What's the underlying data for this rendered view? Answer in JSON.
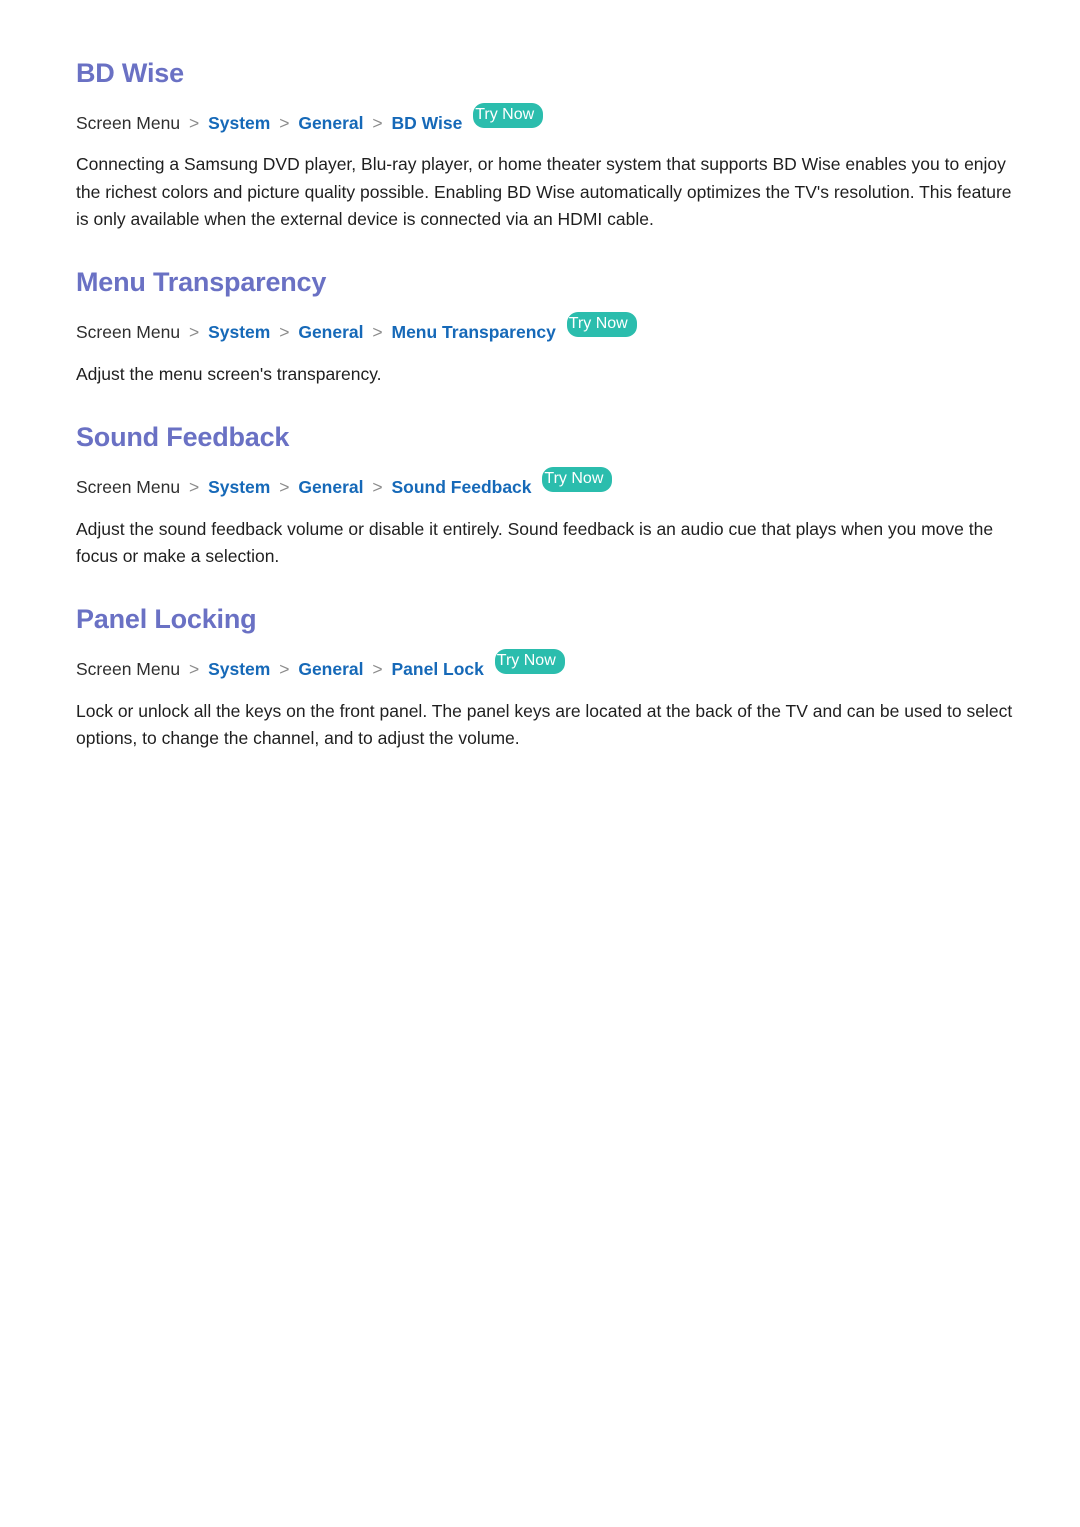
{
  "document": {
    "sections": [
      {
        "title": "BD Wise",
        "breadcrumb": {
          "root": "Screen Menu",
          "separator": ">",
          "links": [
            "System",
            "General",
            "BD Wise"
          ],
          "badge": "Try Now"
        },
        "body": "Connecting a Samsung DVD player, Blu-ray player, or home theater system that supports BD Wise enables you to enjoy the richest colors and picture quality possible. Enabling BD Wise automatically optimizes the TV's resolution. This feature is only available when the external device is connected via an HDMI cable."
      },
      {
        "title": "Menu Transparency",
        "breadcrumb": {
          "root": "Screen Menu",
          "separator": ">",
          "links": [
            "System",
            "General",
            "Menu Transparency"
          ],
          "badge": "Try Now"
        },
        "body": "Adjust the menu screen's transparency."
      },
      {
        "title": "Sound Feedback",
        "breadcrumb": {
          "root": "Screen Menu",
          "separator": ">",
          "links": [
            "System",
            "General",
            "Sound Feedback"
          ],
          "badge": "Try Now"
        },
        "body": "Adjust the sound feedback volume or disable it entirely. Sound feedback is an audio cue that plays when you move the focus or make a selection."
      },
      {
        "title": "Panel Locking",
        "breadcrumb": {
          "root": "Screen Menu",
          "separator": ">",
          "links": [
            "System",
            "General",
            "Panel Lock"
          ],
          "badge": "Try Now"
        },
        "body": "Lock or unlock all the keys on the front panel. The panel keys are located at the back of the TV and can be used to select options, to change the channel, and to adjust the volume."
      }
    ],
    "colors": {
      "heading": "#6a71c4",
      "link": "#1669b8",
      "badge_bg": "#2bbdad",
      "badge_text": "#ffffff",
      "body_text": "#1f1f1f",
      "separator": "#8b8b8b",
      "background": "#ffffff"
    }
  }
}
